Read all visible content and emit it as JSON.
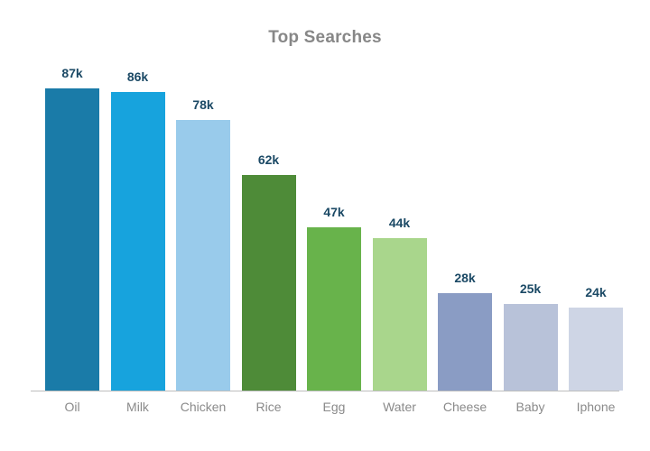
{
  "chart_data": {
    "type": "bar",
    "title": "Top Searches",
    "xlabel": "",
    "ylabel": "",
    "ylim": [
      0,
      95
    ],
    "grid": false,
    "legend": "none",
    "value_suffix": "k",
    "categories": [
      "Oil",
      "Milk",
      "Chicken",
      "Rice",
      "Egg",
      "Water",
      "Cheese",
      "Baby",
      "Iphone"
    ],
    "values": [
      87,
      86,
      78,
      62,
      47,
      44,
      28,
      25,
      24
    ],
    "value_labels": [
      "87k",
      "86k",
      "78k",
      "62k",
      "47k",
      "44k",
      "28k",
      "25k",
      "24k"
    ],
    "bar_colors": [
      "#1a7ba8",
      "#17a3dd",
      "#99cbeb",
      "#4e8b38",
      "#68b34b",
      "#a9d68c",
      "#8a9cc4",
      "#b8c2d9",
      "#ced5e5"
    ],
    "title_color": "#878787",
    "value_label_color": "#1b4965",
    "category_label_color": "#8a8a8a",
    "axis_line_color": "#bdbdbd",
    "background_color": "#ffffff"
  }
}
